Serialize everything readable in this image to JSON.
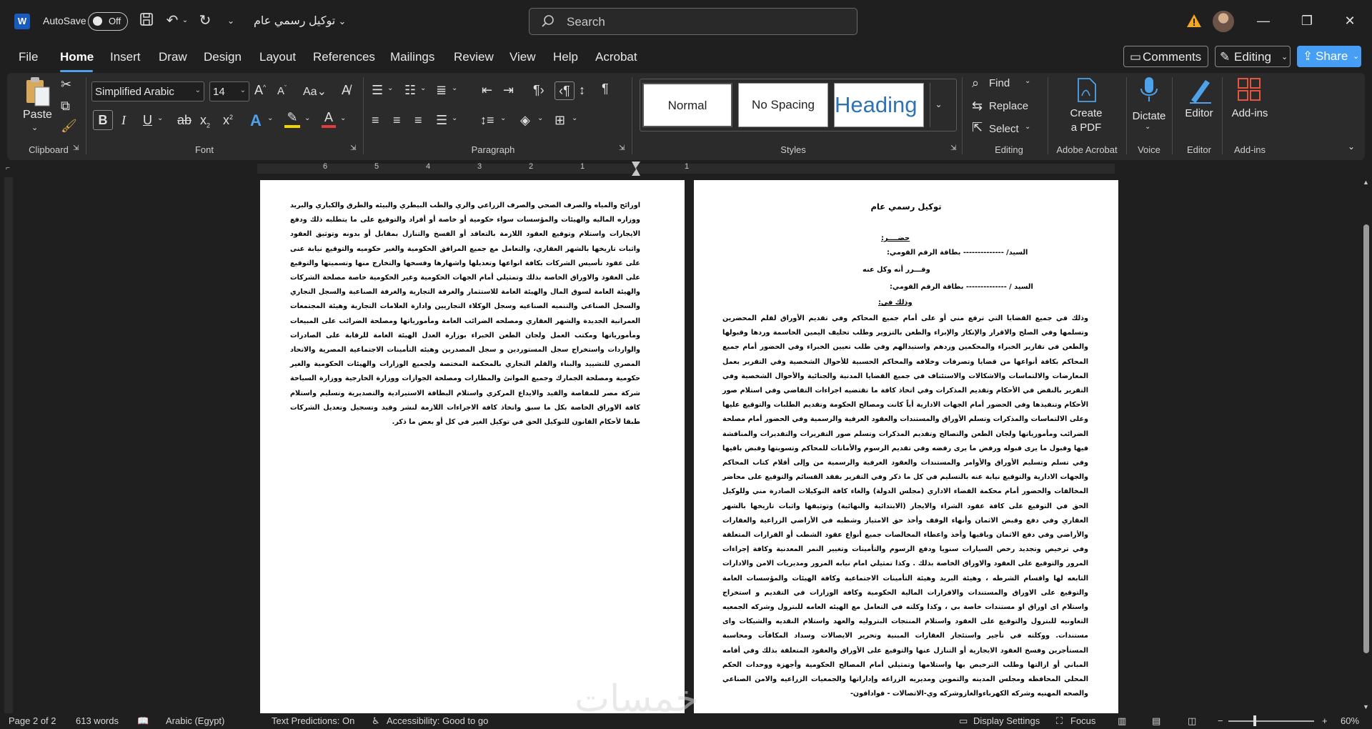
{
  "titlebar": {
    "autosave_label": "AutoSave",
    "autosave_state": "Off",
    "doc_title": "توكيل رسمي عام",
    "search_placeholder": "Search"
  },
  "menu": {
    "tabs": [
      "File",
      "Home",
      "Insert",
      "Draw",
      "Design",
      "Layout",
      "References",
      "Mailings",
      "Review",
      "View",
      "Help",
      "Acrobat"
    ],
    "active": "Home",
    "comments": "Comments",
    "editing": "Editing",
    "share": "Share"
  },
  "ribbon": {
    "clipboard": {
      "paste": "Paste",
      "label": "Clipboard"
    },
    "font": {
      "name": "Simplified Arabic",
      "size": "14",
      "label": "Font"
    },
    "paragraph": {
      "label": "Paragraph"
    },
    "styles": {
      "items": [
        "Normal",
        "No Spacing",
        "Heading 1"
      ],
      "label": "Styles"
    },
    "editing": {
      "find": "Find",
      "replace": "Replace",
      "select": "Select",
      "label": "Editing"
    },
    "acrobat": {
      "create": "Create\na PDF",
      "create_line1": "Create",
      "create_line2": "a PDF",
      "label": "Adobe Acrobat"
    },
    "voice": {
      "dictate": "Dictate",
      "label": "Voice"
    },
    "editor": {
      "editor": "Editor",
      "label": "Editor"
    },
    "addins": {
      "addins": "Add-ins",
      "label": "Add-ins"
    }
  },
  "ruler": {
    "numbers": [
      "6",
      "5",
      "4",
      "3",
      "2",
      "1",
      "1"
    ]
  },
  "document": {
    "left_page_text": "اورائح والمياه والصرف الصحي والصرف الزراعي والري والطب البيطري والبيئه والطرق والكباري والبريد ووزاره الماليه والهيئات والمؤسسات سواء حكومية أو خاصة أو أفراد والتوقيع على ما يتطلبه ذلك ودفع الايجارات واستلام وتوقيع العقود اللازمة بالتعاقد أو الفسخ والتنازل بمقابل أو بدونه وتوثيق العقود واثبات تاريخها بالشهر العقاري، والتعامل مع جميع المرافق الحكومية والغير حكوميه والتوقيع نيابة عنى على عقود تأسيس الشركات بكافة انواعها وتعديلها واشهارها وفسخها والتخارج منها وتسميتها والتوقيع على العقود والاوراق الخاصة بذلك وتمثيلي أمام الجهات الحكومية وغير الحكومية خاصة مصلحة الشركات والهيئة العامة لسوق المال والهيئة العامة للاستثمار والغرفة التجارية والغرفة الصناعية والسجل التجاري والسجل الصناعي والتنميه الصناعيه وسجل الوكلاء التجاريين وادارة العلامات التجارية وهيئة المجتمعات العمرانية الجديدة والشهر العقاري ومصلحه الضرائب العامة ومأمورياتها ومصلحة الضرائب على المبيعات ومأمورياتها ومكتب العمل ولجان الطعن الخبراء بوزارة العدل الهيئة العامة للرقابة على الصادرات والواردات واستخراج سجل المستوردين و سجل المصدرين وهيئه التأمينات الاجتماعية المصرية والاتحاد المصري للتشييد والبناء والقلم التجاري بالمحكمة المختصة ولجميع الوزارات والهيئات الحكومية والغير حكومية ومصلحة الجمارك وجميع الموانئ والمطارات ومصلحة الجوازات ووزارة الخارجية ووزارة السياحة شركة مصر للمقاصة والقيد والايداع المركزي واستلام البطاقة الاستيرادية والتصديرية وتسليم واستلام كافة الاوراق الخاصة بكل ما سبق واتخاذ كافة الاجراءات اللازمة لنشر وقيد وتسجيل وتعديل الشركات طبقا لأحكام القانون للتوكيل الحق في توكيل الغير في كل أو بعض ما ذكر.",
    "right_title": "توكيل رسمي عام",
    "attendance": "حضــــر:",
    "line_sayed1": "السيد/  --------------  بطاقة الرقم القومي:",
    "line_ack": "وقـــرر أنه وكل عنه",
    "line_sayed2": "السيد /  --------------  بطاقة الرقم القومي:",
    "line_that": "وذلك في:",
    "right_body": "وذلك في جميع القضايا التي ترفع مني أو على أمام جميع المحاكم وفي تقديم الأوراق لقلم المحضرين وتسلمها وفي الصلح والاقرار والإنكار والإبراء والطعن بالتزوير وطلب تحليف اليمين الحاسمة وردها وقبولها والطعن في تقارير الخبراء والمحكمين وردهم واستبدالهم وفي طلب تعيين الخبراء وفي الحضور أمام جميع المحاكم بكافة أنواعها من قضايا وتصرفات وخلافه والمحاكم الحسبية للأحوال الشخصية وفي التقرير بعمل المعارضات والالتماسات والاشكالات والاستئناف في جميع القضايا المدنية والجنائية والأحوال الشخصية وفي التقرير بالنقض في الأحكام وتقديم المذكرات وفي اتخاذ كافة ما تقتضيه اجراءات التقاضي وفي استلام صور الأحكام وتنفيذها وفي الحضور أمام الجهات الادارية أياً كانت ومصالح الحكومة وتقديم الطلبات والتوقيع عليها وعلى الالتماسات والمذكرات وتسلم الأوراق والمستندات والعقود العرفية والرسمية وفي الحضور أمام مصلحة الضرائب ومأمورياتها ولجان الطعن والتصالح وتقديم المذكرات وتسلم صور التقريرات والتقديرات والمناقشة فيها وقبول ما يرى قبوله ورفض ما يرى رفضه وفي تقديم الرسوم والأمانات للمحاكم وتسويتها وقبض باقيها وفي تسلم وتسليم الأوراق والأوامر والمستندات والعقود العرفية والرسمية من وإلى أقلام كتاب المحاكم والجهات الادارية والتوقيع نيابة عنه بالتسليم في كل ما ذكر وفي التقرير بفقد القسائم والتوقيع على محاضر المخالفات والحضور أمام محكمة القضاء الاداري (مجلس الدولة) والغاء كافة التوكيلات الصادرة مني وللوكيل الحق في التوقيع على كافة عقود الشراء والايجار (الابتدائية والنهائية) وتوثيقها واثبات تاريخها بالشهر العقاري وفي دفع وقبض الاثمان وأنهاء الوقف وأخذ حق الامتياز وشطبه في الأراضي الزراعية والعقارات والأراضي وفي دفع الاثمان وباقيها وأخذ واعطاء المخالصات جميع أنواع عقود الشطب أو القرارات المتعلقة وفي ترخيص وتجديد رخص السيارات سنويا ودفع الرسوم والتأمينات وتغيير النمر المعدنية وكافة إجراءات المرور والتوقيع على العقود والاوراق الخاصة بذلك . وكذا تمثيلي امام نيابه المرور ومديريات الامن والادارات التابعه لها واقسام الشرطه ، وهيئة البريد وهيئة التأمينات الاجتماعية وكافة الهيئات والمؤسسات العامة والتوقيع على الاوراق والمستندات والاقرارات المالية الحكومية وكافة الوزارات في التقديم و استخراج واستلام اى اوراق او مستندات خاصة بي ، وكذا وكلته في التعامل مع الهيئه العامه للبترول وشركه الجمعيه التعاونيه للبترول والتوقيع على العقود واستلام المنتجات البتروليه والعهد واستلام النقديه والشيكات واى مستندات. ووكلته في تأجير واستئجار العقارات المبنية وتحرير الايصالات وسداد المكافآت ومحاسبة المستأجرين وفسخ العقود الايجارية أو التنازل عنها والتوقيع على الأوراق والعقود المتعلقة بذلك وفي أقامه المباني أو ازالتها وطلب الترخيص بها واستلامها وتمثيلي أمام المصالح الحكومية وأجهزة ووحدات الحكم المحلي المحافظه ومجلس المدينه والتموين ومديريه الزراعه وإداراتها والجمعيات الزراعيه والامن الصناعي والصحه المهنيه وشركه الكهرباءوالغازوشركه وي-الاتصالات - فوادافون-"
  },
  "watermark": "خمسات",
  "status": {
    "page": "Page 2 of 2",
    "words": "613 words",
    "language": "Arabic (Egypt)",
    "predictions": "Text Predictions: On",
    "accessibility": "Accessibility: Good to go",
    "display": "Display Settings",
    "focus": "Focus",
    "zoom": "60%"
  },
  "colors": {
    "accent": "#4ea2ea",
    "share": "#479ef5",
    "word_blue": "#185abd",
    "heading_blue": "#2e74b5"
  }
}
